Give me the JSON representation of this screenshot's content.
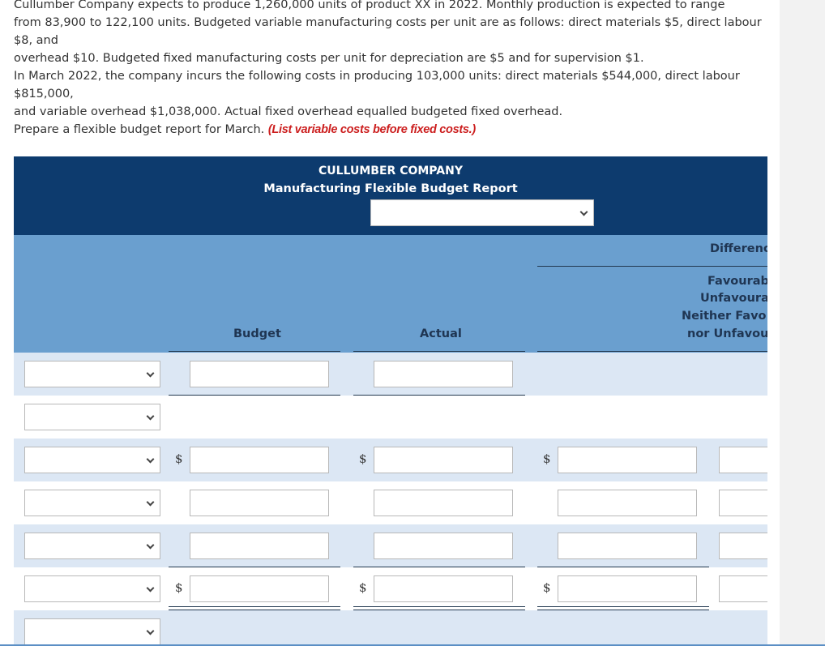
{
  "problem": {
    "line1": "Cullumber Company expects to produce 1,260,000 units of product XX in 2022. Monthly production is expected to range",
    "line2": "from 83,900 to 122,100 units. Budgeted variable manufacturing costs per unit are as follows: direct materials $5, direct labour $8, and",
    "line3": "overhead $10. Budgeted fixed manufacturing costs per unit for depreciation are $5 and for supervision $1.",
    "line4": "In March 2022, the company incurs the following costs in producing 103,000 units: direct materials $544,000, direct labour $815,000,",
    "line5": "and variable overhead $1,038,000. Actual fixed overhead equalled budgeted fixed overhead.",
    "instruction": "Prepare a flexible budget report for March.",
    "hint": "(List variable costs before fixed costs.)"
  },
  "report": {
    "company": "CULLUMBER COMPANY",
    "title": "Manufacturing Flexible Budget Report",
    "period_value": "",
    "columns": {
      "budget": "Budget",
      "actual": "Actual",
      "difference": "Differenc",
      "fav1": "Favourab",
      "fav2": "Unfavoura",
      "fav3": "Neither Favo",
      "fav4": "nor Unfavou"
    },
    "currency": "$"
  }
}
